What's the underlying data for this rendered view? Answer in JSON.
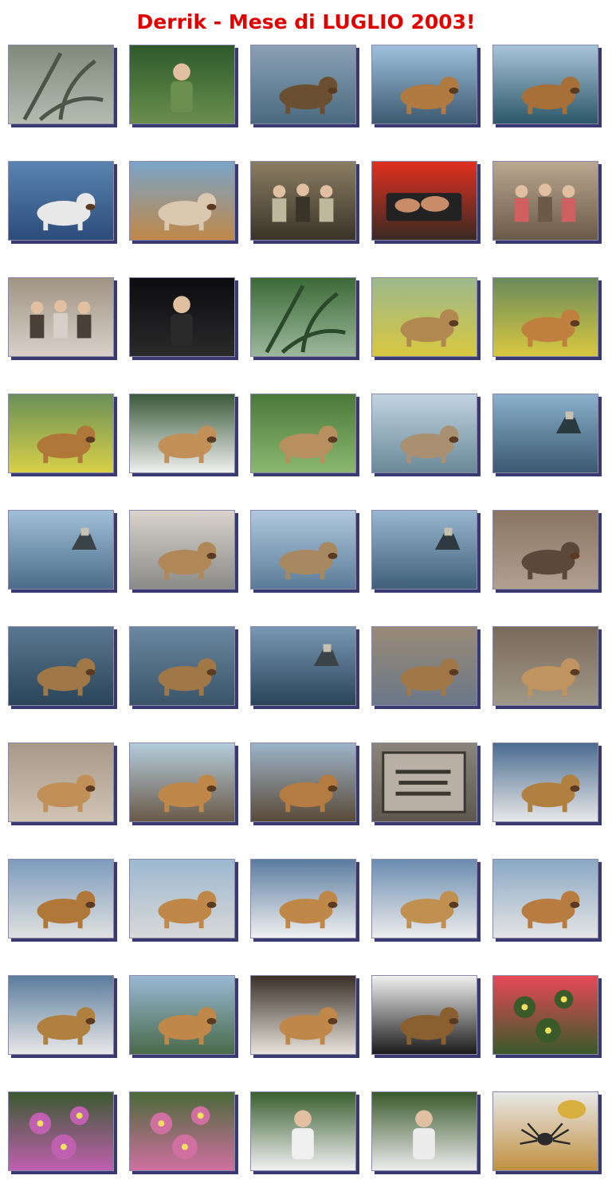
{
  "page": {
    "title": "Derrik - Mese di LUGLIO 2003!"
  },
  "thumbnails": [
    {
      "subject": "caterpillar on branch",
      "palette": [
        "#7e8a7c",
        "#b4bcb0",
        "#4c5648"
      ],
      "icon": "plant"
    },
    {
      "subject": "woman with dog by gate",
      "palette": [
        "#2e5a2a",
        "#6a8e4e",
        "#b08a5a"
      ],
      "icon": "person"
    },
    {
      "subject": "dog wading in sea",
      "palette": [
        "#8aa0b4",
        "#4a6a80",
        "#6a5030"
      ],
      "icon": "dog"
    },
    {
      "subject": "dog on boat, castle",
      "palette": [
        "#9ec0dc",
        "#3c5a70",
        "#b07a40"
      ],
      "icon": "dog"
    },
    {
      "subject": "dog on boat, harbour castle",
      "palette": [
        "#a8c4d8",
        "#2c5868",
        "#a67038"
      ],
      "icon": "dog"
    },
    {
      "subject": "dog lying on boat bow",
      "palette": [
        "#5a84b0",
        "#2c4c7a",
        "#e8e8e8"
      ],
      "icon": "dog"
    },
    {
      "subject": "dog close-up in harbour",
      "palette": [
        "#7aa4c8",
        "#c08848",
        "#d8c8b0"
      ],
      "icon": "dog"
    },
    {
      "subject": "group of people indoors",
      "palette": [
        "#8a7e62",
        "#3a3328",
        "#c0b89c"
      ],
      "icon": "people"
    },
    {
      "subject": "meat on grill",
      "palette": [
        "#e03020",
        "#3a2a24",
        "#c88c68"
      ],
      "icon": "food"
    },
    {
      "subject": "family at dinner table",
      "palette": [
        "#b8a890",
        "#6a5a48",
        "#d06060"
      ],
      "icon": "people"
    },
    {
      "subject": "people at table",
      "palette": [
        "#a09484",
        "#d8d0c8",
        "#4a4038"
      ],
      "icon": "people"
    },
    {
      "subject": "woman petting dog at night",
      "palette": [
        "#0c0c10",
        "#2a2a2a",
        "#c82020"
      ],
      "icon": "person"
    },
    {
      "subject": "sunlight through garden",
      "palette": [
        "#3c6a38",
        "#9cb89a",
        "#2a4a2a"
      ],
      "icon": "plant"
    },
    {
      "subject": "dog on yellow bench",
      "palette": [
        "#9cb88c",
        "#d8c840",
        "#b08850"
      ],
      "icon": "dog"
    },
    {
      "subject": "dog with red ball",
      "palette": [
        "#6a8a5a",
        "#d8c840",
        "#c08040"
      ],
      "icon": "dog"
    },
    {
      "subject": "dog with red ball on lawn",
      "palette": [
        "#6a9058",
        "#d8d048",
        "#b07838"
      ],
      "icon": "dog"
    },
    {
      "subject": "dog yawning close-up",
      "palette": [
        "#3a5a3a",
        "#f0f0f0",
        "#c09058"
      ],
      "icon": "dog"
    },
    {
      "subject": "dog on grass with leaves",
      "palette": [
        "#4a7a3a",
        "#8ab870",
        "#b89060"
      ],
      "icon": "dog"
    },
    {
      "subject": "dog swimming near castle",
      "palette": [
        "#c0d4e0",
        "#6a8898",
        "#a89070"
      ],
      "icon": "dog"
    },
    {
      "subject": "sea with castle on cliff",
      "palette": [
        "#8ab0cc",
        "#3a5a70",
        "#2a3a40"
      ],
      "icon": "sea"
    },
    {
      "subject": "calm sea with castle",
      "palette": [
        "#a0c0d8",
        "#4a6c88",
        "#3a4448"
      ],
      "icon": "sea"
    },
    {
      "subject": "dog on sandy beach",
      "palette": [
        "#d8d4cc",
        "#8a8a88",
        "#b08858"
      ],
      "icon": "dog"
    },
    {
      "subject": "dog swimming, coastline",
      "palette": [
        "#b0c8dc",
        "#5a7c98",
        "#a88860"
      ],
      "icon": "dog"
    },
    {
      "subject": "sea with castle",
      "palette": [
        "#98b8d0",
        "#3e6078",
        "#2e3a40"
      ],
      "icon": "sea"
    },
    {
      "subject": "dog on rocky beach",
      "palette": [
        "#8a7462",
        "#b0a090",
        "#5a4838"
      ],
      "icon": "dog"
    },
    {
      "subject": "dog swimming toward camera",
      "palette": [
        "#5a7890",
        "#2a4458",
        "#a07848"
      ],
      "icon": "dog"
    },
    {
      "subject": "dog swimming far",
      "palette": [
        "#6a88a0",
        "#3a5468",
        "#a07848"
      ],
      "icon": "dog"
    },
    {
      "subject": "sea with castle at dusk",
      "palette": [
        "#7898b4",
        "#2a4458",
        "#3a4448"
      ],
      "icon": "sea"
    },
    {
      "subject": "dog in shallow water, rocks",
      "palette": [
        "#9a8a78",
        "#6a7888",
        "#a07848"
      ],
      "icon": "dog"
    },
    {
      "subject": "dog standing on beach",
      "palette": [
        "#7a6a5a",
        "#a09888",
        "#c09460"
      ],
      "icon": "dog"
    },
    {
      "subject": "dog lying on sand",
      "palette": [
        "#a89888",
        "#d0c4b4",
        "#c09058"
      ],
      "icon": "dog"
    },
    {
      "subject": "dog lying on beach, castle",
      "palette": [
        "#b4ccdc",
        "#6a5a48",
        "#c08848"
      ],
      "icon": "dog"
    },
    {
      "subject": "dog lying near sea",
      "palette": [
        "#9cb4c8",
        "#5a4a38",
        "#b47c40"
      ],
      "icon": "dog"
    },
    {
      "subject": "stone plaque",
      "palette": [
        "#8a847a",
        "#5c5850",
        "#b8b0a4"
      ],
      "icon": "plaque"
    },
    {
      "subject": "dog on boat with bag",
      "palette": [
        "#4a6c90",
        "#e8e8e8",
        "#b08040"
      ],
      "icon": "dog"
    },
    {
      "subject": "dog standing on boat, marina",
      "palette": [
        "#7c9cbc",
        "#e0e0e0",
        "#b07838"
      ],
      "icon": "dog"
    },
    {
      "subject": "dog on boat, castle marina",
      "palette": [
        "#9cb8d0",
        "#d8d8d8",
        "#c08848"
      ],
      "icon": "dog"
    },
    {
      "subject": "dog lying on boat bow",
      "palette": [
        "#5a7ca0",
        "#f0f0f0",
        "#c08848"
      ],
      "icon": "dog"
    },
    {
      "subject": "dog sitting on boat",
      "palette": [
        "#6a8cb0",
        "#ececec",
        "#c09050"
      ],
      "icon": "dog"
    },
    {
      "subject": "dog on boat near town",
      "palette": [
        "#8aa8c4",
        "#e4e4e4",
        "#b87c40"
      ],
      "icon": "dog"
    },
    {
      "subject": "dog on boat, hills",
      "palette": [
        "#5a7c9c",
        "#e8e8e8",
        "#b08040"
      ],
      "icon": "dog"
    },
    {
      "subject": "dog close-up, island",
      "palette": [
        "#98b8d4",
        "#4a6a4a",
        "#c08848"
      ],
      "icon": "dog"
    },
    {
      "subject": "dog resting in cabin",
      "palette": [
        "#3a3028",
        "#e8e4dc",
        "#c08848"
      ],
      "icon": "dog"
    },
    {
      "subject": "dog under boat deck",
      "palette": [
        "#f0f0f0",
        "#1a1a1a",
        "#8a6030"
      ],
      "icon": "dog"
    },
    {
      "subject": "red flowers",
      "palette": [
        "#e84858",
        "#3a5a2a",
        "#f0a0a8"
      ],
      "icon": "flower"
    },
    {
      "subject": "garden with pink flowers",
      "palette": [
        "#3a5a30",
        "#c060b0",
        "#e0e0e0"
      ],
      "icon": "flower"
    },
    {
      "subject": "garden arch with flowers",
      "palette": [
        "#4a6a38",
        "#d070a0",
        "#e8e8e8"
      ],
      "icon": "flower"
    },
    {
      "subject": "woman among flowers",
      "palette": [
        "#3a6030",
        "#f0f0f0",
        "#3ab0d8"
      ],
      "icon": "person"
    },
    {
      "subject": "woman among flowers",
      "palette": [
        "#3a5a2c",
        "#ececec",
        "#40a8d0"
      ],
      "icon": "person"
    },
    {
      "subject": "spider toy on table",
      "palette": [
        "#e8e8e8",
        "#c09040",
        "#2a2a2a"
      ],
      "icon": "spider"
    }
  ]
}
